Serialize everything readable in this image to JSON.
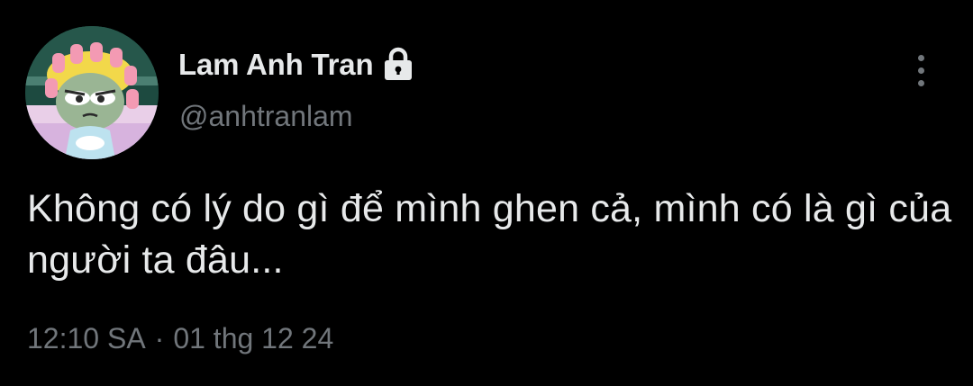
{
  "author": {
    "display_name": "Lam Anh Tran",
    "handle": "@anhtranlam",
    "protected_icon": "lock-icon",
    "avatar_description": "cartoon avatar"
  },
  "menu": {
    "icon": "more-vertical-icon"
  },
  "tweet": {
    "text": "Không có lý do gì để mình ghen cả, mình có là gì của người ta đâu..."
  },
  "meta": {
    "time": "12:10 SA",
    "separator": "·",
    "date": "01 thg 12 24"
  },
  "colors": {
    "background": "#000000",
    "primary_text": "#e7e9ea",
    "secondary_text": "#71767b"
  }
}
